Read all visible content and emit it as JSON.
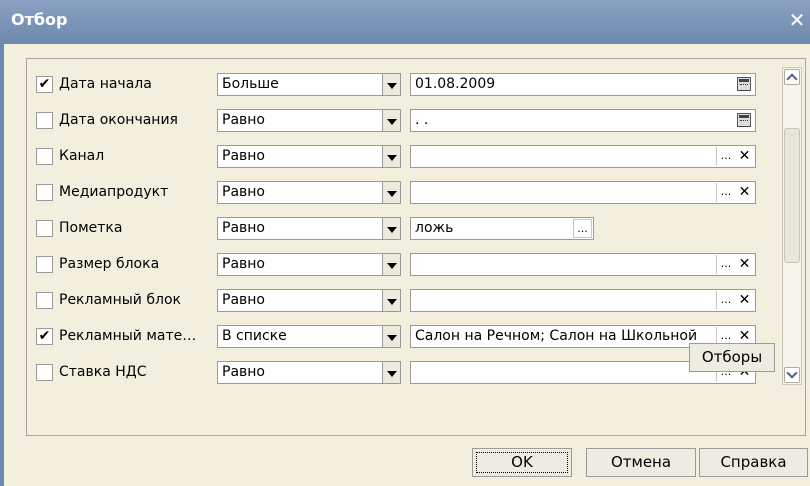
{
  "dialog": {
    "title": "Отбор",
    "close_glyph": "✕"
  },
  "rows": [
    {
      "checked": true,
      "label": "Дата начала",
      "condition": "Больше",
      "value": "01.08.2009",
      "control": "date"
    },
    {
      "checked": false,
      "label": "Дата окончания",
      "condition": "Равно",
      "value": " .  .",
      "control": "date"
    },
    {
      "checked": false,
      "label": "Канал",
      "condition": "Равно",
      "value": "",
      "control": "ref"
    },
    {
      "checked": false,
      "label": "Медиапродукт",
      "condition": "Равно",
      "value": "",
      "control": "ref"
    },
    {
      "checked": false,
      "label": "Пометка",
      "condition": "Равно",
      "value": "ложь",
      "control": "bool"
    },
    {
      "checked": false,
      "label": "Размер блока",
      "condition": "Равно",
      "value": "",
      "control": "ref"
    },
    {
      "checked": false,
      "label": "Рекламный блок",
      "condition": "Равно",
      "value": "",
      "control": "ref"
    },
    {
      "checked": true,
      "label": "Рекламный мате…",
      "condition": "В списке",
      "value": "Салон на Речном; Салон на Школьной",
      "control": "ref"
    },
    {
      "checked": false,
      "label": "Ставка НДС",
      "condition": "Равно",
      "value": "",
      "control": "ref"
    }
  ],
  "buttons": {
    "filters": "Отборы",
    "ok": "OK",
    "cancel": "Отмена",
    "help": "Справка"
  },
  "glyphs": {
    "check": "✔",
    "ellipsis": "...",
    "clear": "✕"
  },
  "colors": {
    "titlebar": "#7791b5",
    "background": "#f3efdf"
  }
}
